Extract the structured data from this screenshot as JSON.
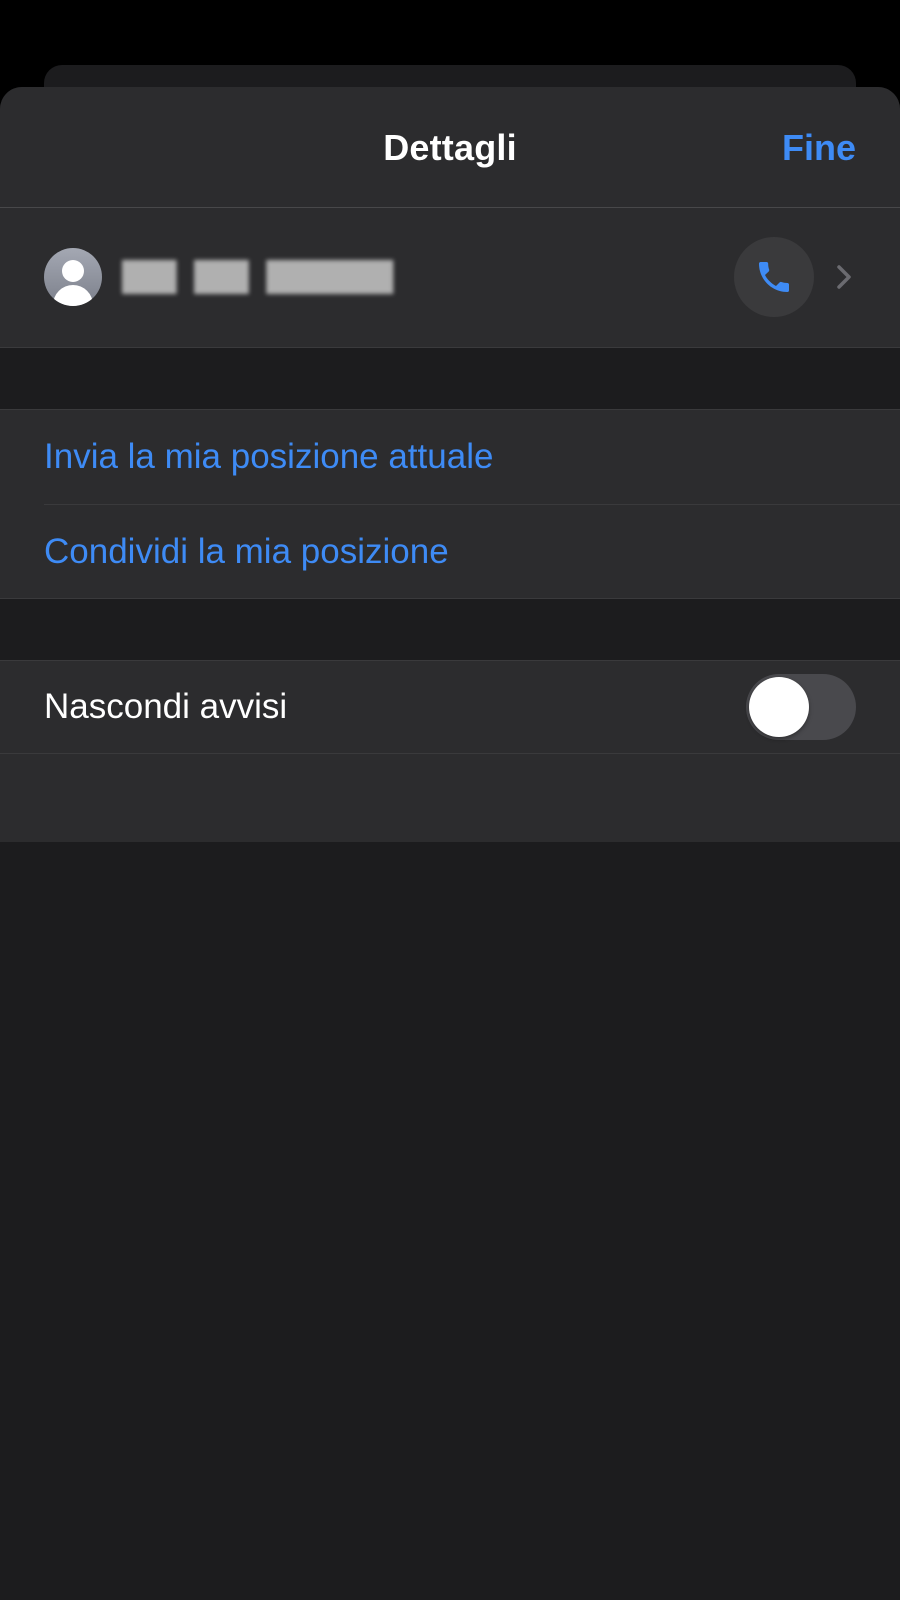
{
  "header": {
    "title": "Dettagli",
    "done_label": "Fine"
  },
  "contact": {
    "name": "███ ███ ███████",
    "name_redacted": true,
    "avatar_icon": "person-placeholder-icon",
    "call_icon": "phone-icon",
    "chevron_icon": "chevron-right-icon"
  },
  "location_actions": [
    {
      "label": "Invia la mia posizione attuale"
    },
    {
      "label": "Condividi la mia posizione"
    }
  ],
  "hide_alerts": {
    "label": "Nascondi avvisi",
    "enabled": false
  },
  "colors": {
    "accent": "#3e8bf5",
    "cell_background": "#2c2c2e",
    "sheet_background": "#1c1c1e",
    "switch_off": "#49494d"
  }
}
